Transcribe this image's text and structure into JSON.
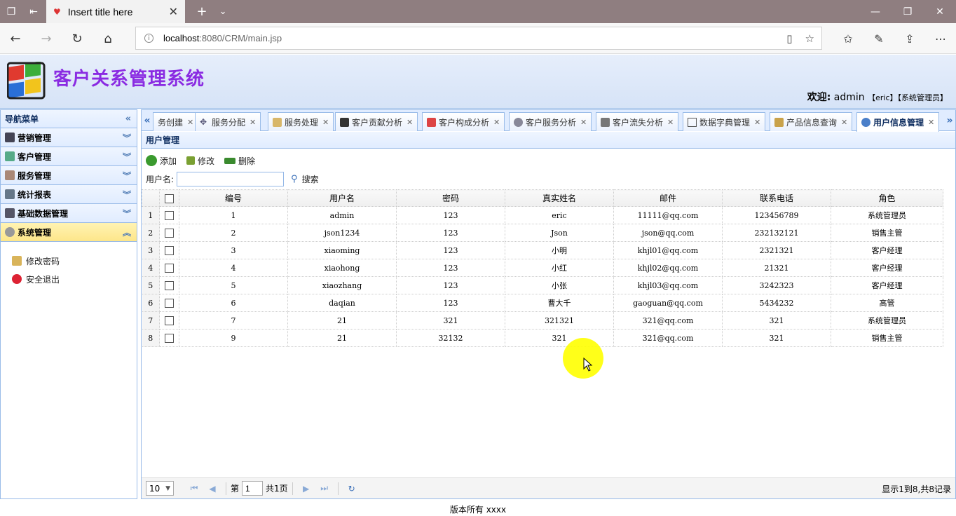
{
  "browser": {
    "tab_title": "Insert title here",
    "url_host": "localhost",
    "url_path": ":8080/CRM/main.jsp"
  },
  "app": {
    "title": "客户关系管理系统",
    "welcome_label": "欢迎:",
    "welcome_user": "admin",
    "welcome_detail": "【eric】【系统管理员】",
    "footer": "版本所有 xxxx"
  },
  "leftnav": {
    "header": "导航菜单",
    "sections": [
      {
        "label": "营销管理",
        "icon": "marketing-icon"
      },
      {
        "label": "客户管理",
        "icon": "customers-icon"
      },
      {
        "label": "服务管理",
        "icon": "service-icon"
      },
      {
        "label": "统计报表",
        "icon": "report-icon"
      },
      {
        "label": "基础数据管理",
        "icon": "database-icon"
      },
      {
        "label": "系统管理",
        "icon": "settings-icon"
      }
    ],
    "sub_items": [
      {
        "label": "修改密码",
        "icon": "key-icon"
      },
      {
        "label": "安全退出",
        "icon": "logout-icon"
      }
    ]
  },
  "tabs": [
    {
      "label": "务创建"
    },
    {
      "label": "服务分配"
    },
    {
      "label": "服务处理"
    },
    {
      "label": "客户贡献分析"
    },
    {
      "label": "客户构成分析"
    },
    {
      "label": "客户服务分析"
    },
    {
      "label": "客户流失分析"
    },
    {
      "label": "数据字典管理"
    },
    {
      "label": "产品信息查询"
    },
    {
      "label": "用户信息管理"
    }
  ],
  "panel": {
    "title": "用户管理",
    "add_label": "添加",
    "edit_label": "修改",
    "delete_label": "删除",
    "search_label": "用户名:",
    "search_value": "",
    "search_button": "搜索"
  },
  "grid": {
    "columns": [
      "编号",
      "用户名",
      "密码",
      "真实姓名",
      "邮件",
      "联系电话",
      "角色"
    ],
    "rows": [
      [
        "1",
        "1",
        "admin",
        "123",
        "eric",
        "11111@qq.com",
        "123456789",
        "系统管理员"
      ],
      [
        "2",
        "2",
        "json1234",
        "123",
        "Json",
        "json@qq.com",
        "232132121",
        "销售主管"
      ],
      [
        "3",
        "3",
        "xiaoming",
        "123",
        "小明",
        "khjl01@qq.com",
        "2321321",
        "客户经理"
      ],
      [
        "4",
        "4",
        "xiaohong",
        "123",
        "小红",
        "khjl02@qq.com",
        "21321",
        "客户经理"
      ],
      [
        "5",
        "5",
        "xiaozhang",
        "123",
        "小张",
        "khjl03@qq.com",
        "3242323",
        "客户经理"
      ],
      [
        "6",
        "6",
        "daqian",
        "123",
        "曹大千",
        "gaoguan@qq.com",
        "5434232",
        "高管"
      ],
      [
        "7",
        "7",
        "21",
        "321",
        "321321",
        "321@qq.com",
        "321",
        "系统管理员"
      ],
      [
        "8",
        "9",
        "21",
        "32132",
        "321",
        "321@qq.com",
        "321",
        "销售主管"
      ]
    ]
  },
  "pager": {
    "page_size": "10",
    "page_prefix": "第",
    "page_value": "1",
    "page_total": "共1页",
    "info": "显示1到8,共8记录"
  }
}
